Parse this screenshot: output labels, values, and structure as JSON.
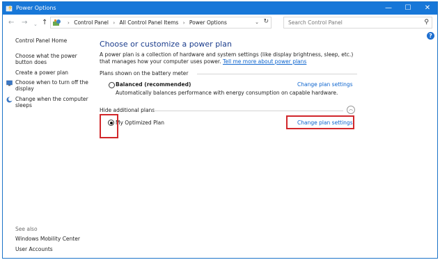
{
  "window": {
    "title": "Power Options",
    "controls": {
      "minimize": "—",
      "maximize": "☐",
      "close": "✕"
    }
  },
  "address_bar": {
    "breadcrumbs": [
      "Control Panel",
      "All Control Panel Items",
      "Power Options"
    ],
    "search_placeholder": "Search Control Panel"
  },
  "left_nav": {
    "home": "Control Panel Home",
    "items": [
      "Choose what the power button does",
      "Create a power plan",
      "Choose when to turn off the display",
      "Change when the computer sleeps"
    ],
    "see_also_label": "See also",
    "see_also_items": [
      "Windows Mobility Center",
      "User Accounts"
    ]
  },
  "main": {
    "heading": "Choose or customize a power plan",
    "description": "A power plan is a collection of hardware and system settings (like display brightness, sleep, etc.) that manages how your computer uses power.",
    "description_link": "Tell me more about power plans",
    "battery_section_label": "Plans shown on the battery meter",
    "hidden_section_label": "Hide additional plans",
    "plans": [
      {
        "name": "Balanced (recommended)",
        "description": "Automatically balances performance with energy consumption on capable hardware.",
        "link": "Change plan settings",
        "selected": false
      },
      {
        "name": "My Optimized Plan",
        "link": "Change plan settings",
        "selected": true
      }
    ]
  },
  "colors": {
    "titlebar": "#1777d8",
    "link": "#0b63ce",
    "heading": "#1a3c8c",
    "highlight": "#d1262a"
  }
}
